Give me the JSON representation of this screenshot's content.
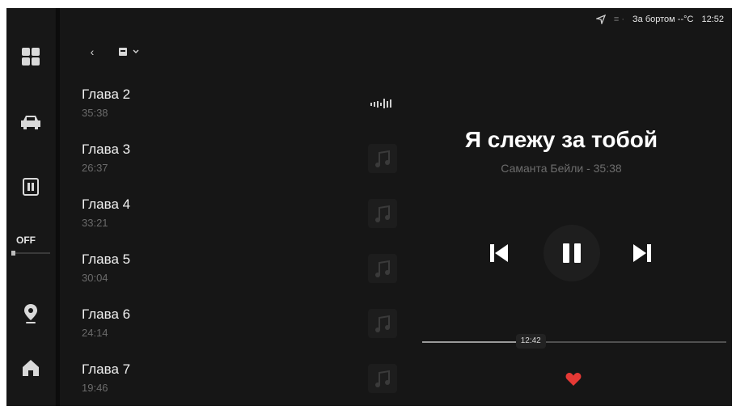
{
  "status_bar": {
    "temperature_label": "За бортом --°C",
    "clock": "12:52",
    "location_icon": "navigation-arrow-icon",
    "signal_icon": "signal-icon"
  },
  "rail": {
    "items": [
      {
        "name": "apps",
        "icon": "grid-icon"
      },
      {
        "name": "car",
        "icon": "car-icon"
      },
      {
        "name": "phone",
        "icon": "phone-screen-icon"
      },
      {
        "name": "climate",
        "label": "OFF"
      },
      {
        "name": "navigation",
        "icon": "map-pin-icon"
      },
      {
        "name": "home",
        "icon": "home-icon"
      }
    ]
  },
  "topbar": {
    "back_icon": "chevron-left-icon",
    "source_icon": "audiobook-icon",
    "dropdown_icon": "chevron-down-icon"
  },
  "chapters": [
    {
      "title": "Глава 2",
      "duration": "35:38",
      "playing": true
    },
    {
      "title": "Глава 3",
      "duration": "26:37",
      "playing": false
    },
    {
      "title": "Глава 4",
      "duration": "33:21",
      "playing": false
    },
    {
      "title": "Глава 5",
      "duration": "30:04",
      "playing": false
    },
    {
      "title": "Глава 6",
      "duration": "24:14",
      "playing": false
    },
    {
      "title": "Глава 7",
      "duration": "19:46",
      "playing": false
    }
  ],
  "now_playing": {
    "title": "Я слежу за тобой",
    "subtitle": "Саманта Бейли - 35:38",
    "elapsed": "12:42",
    "progress_fraction": 0.357,
    "liked": true,
    "colors": {
      "like": "#e53935"
    }
  }
}
